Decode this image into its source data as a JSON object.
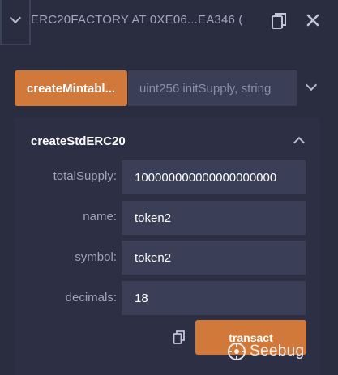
{
  "header": {
    "title": "ERC20FACTORY AT 0XE06...EA346 (",
    "copy_icon": "copy-icon",
    "close_icon": "close-icon",
    "expand_icon": "chevron-down-icon"
  },
  "mintable": {
    "button_label": "createMintabl...",
    "input_placeholder": "uint256 initSupply, string"
  },
  "std_erc20": {
    "title": "createStdERC20",
    "fields": [
      {
        "label": "totalSupply:",
        "value": "100000000000000000000"
      },
      {
        "label": "name:",
        "value": "token2"
      },
      {
        "label": "symbol:",
        "value": "token2"
      },
      {
        "label": "decimals:",
        "value": "18"
      }
    ],
    "transact_label": "transact"
  },
  "watermark": {
    "text": "Seebug"
  },
  "colors": {
    "background": "#2a2c3f",
    "accent": "#d1793a",
    "input_bg": "#3a3e57"
  }
}
